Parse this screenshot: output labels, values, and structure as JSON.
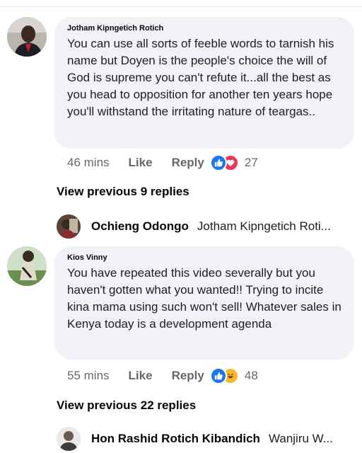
{
  "comments": [
    {
      "author": "Jotham Kipngetich Rotich",
      "text": "You can use all sorts of feeble words to tarnish his name but Doyen is the people's choice the will of God is supreme you can't refute it...all the best as you head to opposition for another ten years hope you'll withstand the irritating nature of teargas..",
      "time": "46 mins",
      "like_label": "Like",
      "reply_label": "Reply",
      "reactions": [
        "like",
        "love"
      ],
      "reaction_count": "27",
      "view_previous": "View previous 9 replies",
      "latest_reply": {
        "name": "Ochieng Odongo",
        "preview": "Jotham Kipngetich Roti..."
      }
    },
    {
      "author": "Kios Vinny",
      "text": "You have repeated this video severally but you haven't gotten what you wanted!! Trying to incite kina mama using such won't sell! Whatever sales in Kenya today is a development agenda",
      "time": "55 mins",
      "like_label": "Like",
      "reply_label": "Reply",
      "reactions": [
        "like",
        "haha"
      ],
      "reaction_count": "48",
      "view_previous": "View previous 22 replies",
      "latest_reply": {
        "name": "Hon Rashid Rotich Kibandich",
        "preview": "Wanjiru W..."
      }
    }
  ],
  "colors": {
    "bubble": "#f0f2f5",
    "like": "#1877f2",
    "love": "#f0334f",
    "haha": "#f7b928",
    "meta_text": "#65676b"
  }
}
